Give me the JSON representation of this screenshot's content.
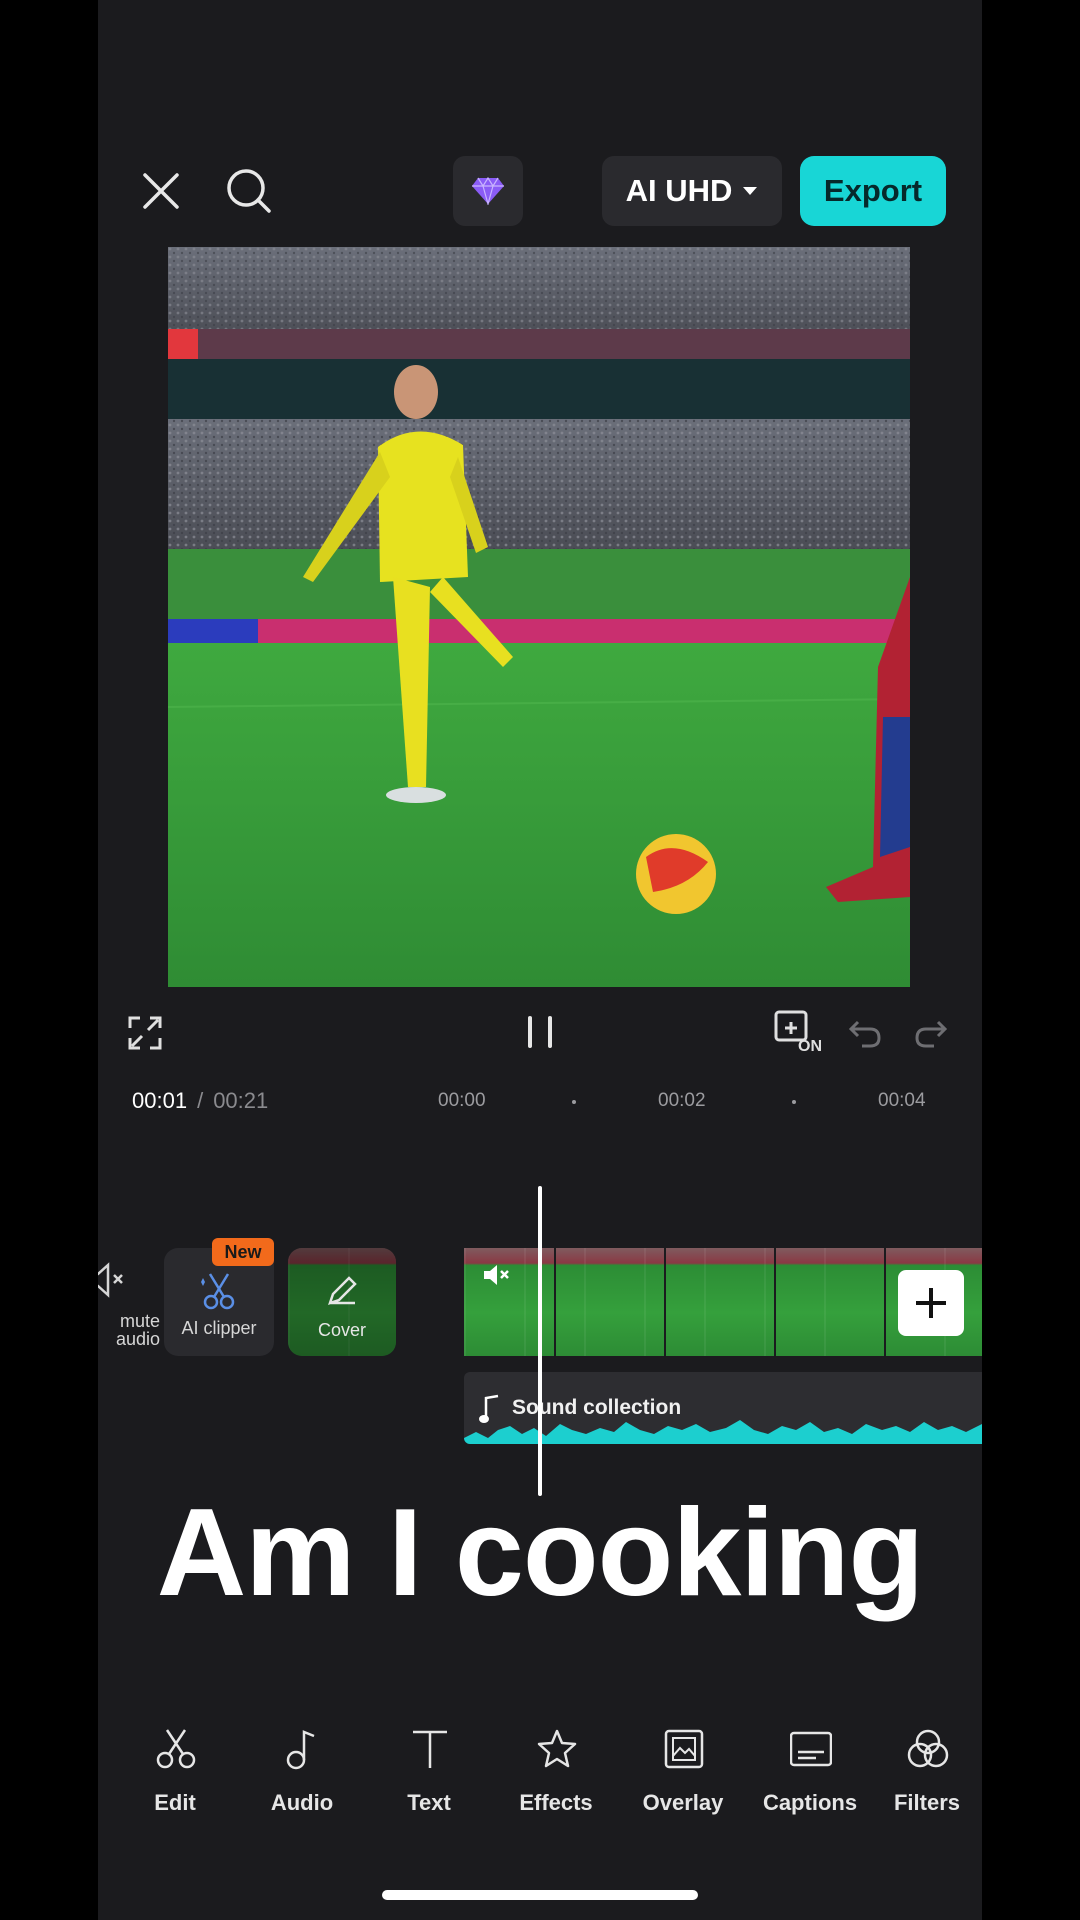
{
  "header": {
    "close_icon": "close-icon",
    "search_icon": "search-icon",
    "premium_icon": "diamond-icon",
    "quality_label": "AI UHD",
    "export_label": "Export",
    "accent": "#18d6d6",
    "premium_color": "#8a5cf6"
  },
  "playback": {
    "current_time": "00:01",
    "separator": "/",
    "total_time": "00:21",
    "ruler": [
      "00:00",
      "00:02",
      "00:04"
    ]
  },
  "controls": {
    "fullscreen_icon": "expand-icon",
    "pause_icon": "pause-icon",
    "keyframe_icon": "keyframe-toggle-icon",
    "keyframe_state": "ON",
    "undo_icon": "undo-icon",
    "redo_icon": "redo-icon"
  },
  "timeline": {
    "mute_label": "mute audio",
    "ai_clipper_label": "AI clipper",
    "ai_clipper_badge": "New",
    "cover_label": "Cover",
    "audio_track_label": "Sound collection",
    "add_clip_icon": "plus-icon",
    "waveform_color": "#1ccfcf",
    "badge_color": "#f26a1b"
  },
  "caption_overlay": "Am I cooking",
  "toolbar": [
    {
      "label": "Edit",
      "icon": "scissors-icon"
    },
    {
      "label": "Audio",
      "icon": "music-note-icon"
    },
    {
      "label": "Text",
      "icon": "text-icon"
    },
    {
      "label": "Effects",
      "icon": "star-effects-icon"
    },
    {
      "label": "Overlay",
      "icon": "overlay-icon"
    },
    {
      "label": "Captions",
      "icon": "captions-icon"
    },
    {
      "label": "Filters",
      "icon": "filters-icon"
    }
  ]
}
